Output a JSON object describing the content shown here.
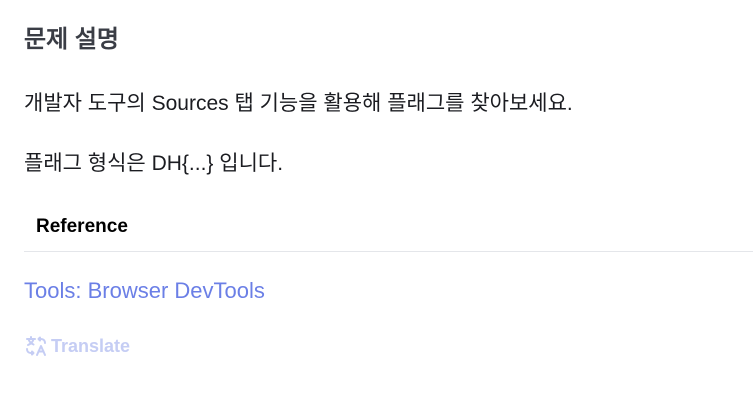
{
  "problem": {
    "title": "문제 설명",
    "paragraphs": [
      "개발자 도구의 Sources 탭 기능을 활용해 플래그를 찾아보세요.",
      "플래그 형식은 DH{...} 입니다."
    ]
  },
  "reference": {
    "header": "Reference",
    "links": [
      {
        "label": "Tools: Browser DevTools"
      }
    ]
  },
  "translate": {
    "label": "Translate",
    "icon": "translate-icon"
  },
  "colors": {
    "link": "#6b7fe6",
    "translate": "#c5cdf4",
    "divider": "#e4e6ea"
  }
}
